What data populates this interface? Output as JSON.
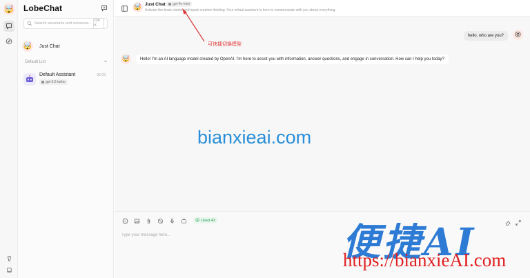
{
  "app": {
    "brand": "LobeChat"
  },
  "sidebar": {
    "search_placeholder": "Search assistants and conversa...",
    "search_shortcut": "Ctrl K",
    "just_chat": {
      "title": "Just Chat"
    },
    "group_label": "Default List",
    "assistant": {
      "title": "Default Assistant",
      "model": "gpt-3.5-turbo",
      "date": "06-03"
    }
  },
  "header": {
    "title": "Just Chat",
    "model": "gpt-4o-mini",
    "description": "Activate the brain cluster and spark creative thinking. Your virtual assistant is here to communicate with you about everything."
  },
  "messages": {
    "user": "hello, who are you?",
    "assistant": "Hello! I'm an AI language model created by OpenAI. I'm here to assist you with information, answer questions, and engage in conversation. How can I help you today?"
  },
  "annotation": {
    "text": "可快捷切换模型",
    "color": "#e03a3a"
  },
  "input": {
    "placeholder": "Type your message here...",
    "token_usage": "Used 43"
  },
  "watermarks": {
    "center": "bianxieai.com",
    "logo": "便捷AI",
    "url": "https://bianxieAI.com"
  },
  "colors": {
    "accent_green": "#1f9d4c",
    "watermark_blue": "#2a8fd8",
    "url_red": "#e02020"
  },
  "icons": [
    "chat-icon",
    "compass-icon",
    "search-icon",
    "new-chat-icon",
    "panel-toggle-icon",
    "robot-icon",
    "emoji-icon",
    "image-icon",
    "paperclip-icon",
    "no-network-icon",
    "mic-icon",
    "plugin-icon",
    "erase-icon",
    "expand-icon",
    "github-icon",
    "book-icon"
  ]
}
